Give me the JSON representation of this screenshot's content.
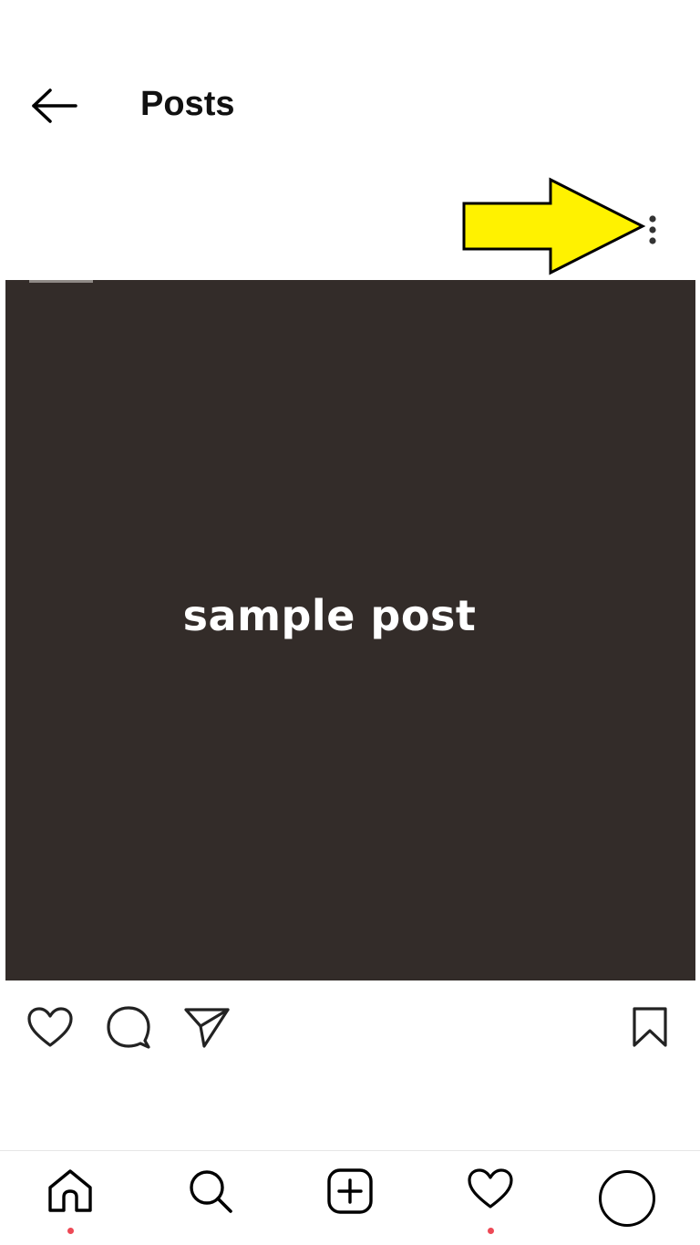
{
  "header": {
    "title": "Posts",
    "back_icon": "arrow-left-icon",
    "more_icon": "vertical-ellipsis-icon"
  },
  "annotation": {
    "icon": "arrow-right-icon",
    "color": "#fff200"
  },
  "post": {
    "image_text": "sample post",
    "background_color": "#332c29"
  },
  "actions": {
    "like_icon": "heart-icon",
    "comment_icon": "comment-icon",
    "share_icon": "paper-plane-icon",
    "save_icon": "bookmark-icon"
  },
  "bottom_nav": {
    "items": [
      {
        "id": "home",
        "icon": "home-icon",
        "notification_dot": true
      },
      {
        "id": "search",
        "icon": "search-icon",
        "notification_dot": false
      },
      {
        "id": "create",
        "icon": "plus-square-icon",
        "notification_dot": false
      },
      {
        "id": "activity",
        "icon": "heart-icon",
        "notification_dot": true
      },
      {
        "id": "profile",
        "icon": "avatar",
        "notification_dot": false
      }
    ],
    "notification_color": "#ed4956"
  }
}
